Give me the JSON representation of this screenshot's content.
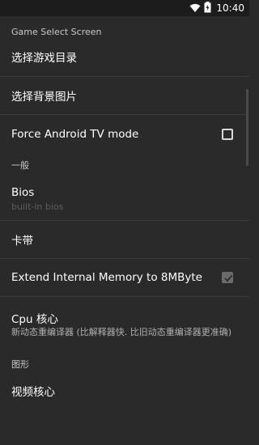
{
  "status_bar": {
    "time": "10:40",
    "icons": [
      "wifi-icon",
      "battery-icon"
    ]
  },
  "game_select": {
    "header": "Game Select Screen",
    "items": [
      {
        "title": "选择游戏目录"
      },
      {
        "title": "选择背景图片"
      },
      {
        "title": "Force Android TV mode",
        "checked": false
      }
    ]
  },
  "general": {
    "header": "一般",
    "bios": {
      "title": "Bios",
      "summary": "built-in bios"
    },
    "cartridge": {
      "title": "卡带"
    },
    "extend_memory": {
      "title": "Extend Internal Memory to 8MByte",
      "checked": true,
      "enabled": false
    },
    "cpu_core": {
      "title": "Cpu 核心",
      "summary": "新动态重编译器 (比解释器快. 比旧动态重编译器更准确)"
    }
  },
  "graphics": {
    "header": "图形",
    "video_core": {
      "title": "视频核心"
    }
  }
}
